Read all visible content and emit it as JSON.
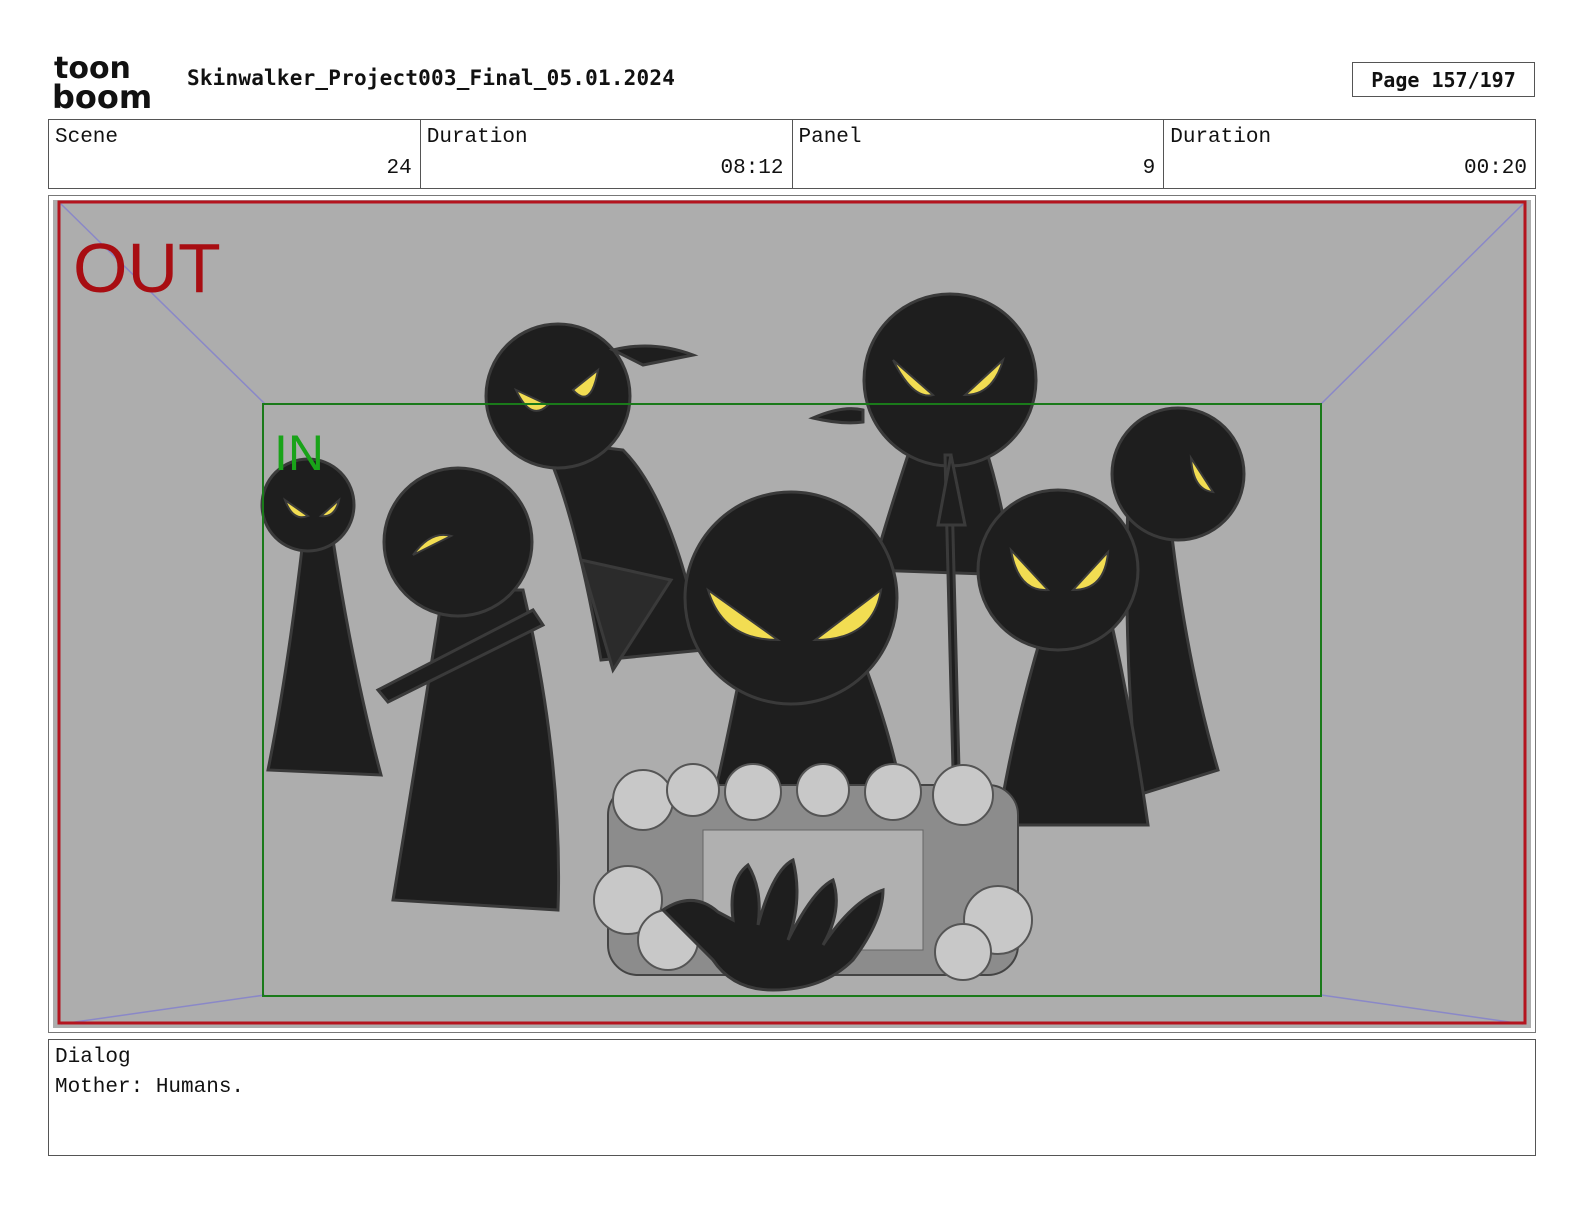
{
  "header": {
    "logo_text_top": "toon",
    "logo_text_bottom": "boom",
    "title": "Skinwalker_Project003_Final_05.01.2024",
    "page_label": "Page 157/197"
  },
  "info": {
    "scene_label": "Scene",
    "scene_value": "24",
    "scene_duration_label": "Duration",
    "scene_duration_value": "08:12",
    "panel_label": "Panel",
    "panel_value": "9",
    "panel_duration_label": "Duration",
    "panel_duration_value": "00:20"
  },
  "panel": {
    "out_label": "OUT",
    "in_label": "IN",
    "colors": {
      "out_frame": "#b4141e",
      "in_frame": "#1a7a1a",
      "in_text": "#19a319",
      "background": "#adadad",
      "figure": "#1e1e1e",
      "eyes": "#f2dd52",
      "guide_lines": "#8a88c8"
    }
  },
  "dialog": {
    "label": "Dialog",
    "text": "Mother: Humans."
  }
}
